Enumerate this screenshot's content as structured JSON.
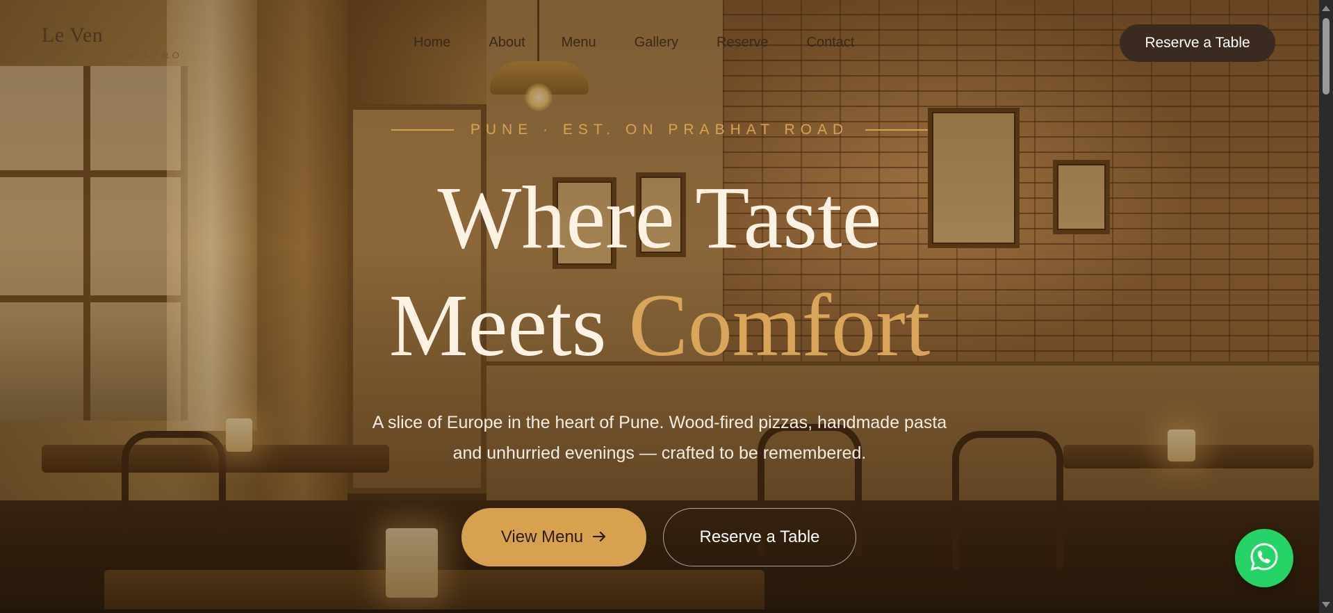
{
  "brand": {
    "name": "Le Ven",
    "tagline": "PIZZERIA · BISTRO"
  },
  "nav": {
    "items": [
      "Home",
      "About",
      "Menu",
      "Gallery",
      "Reserve",
      "Contact"
    ],
    "cta_label": "Reserve a Table"
  },
  "hero": {
    "eyebrow": "PUNE · EST. ON PRABHAT ROAD",
    "headline_line1": "Where Taste",
    "headline_line2_plain": "Meets ",
    "headline_line2_accent": "Comfort",
    "subtitle_line1": "A slice of Europe in the heart of Pune. Wood-fired pizzas, handmade pasta",
    "subtitle_line2": "and unhurried evenings — crafted to be remembered.",
    "primary_button": "View Menu",
    "primary_button_icon": "arrow-right-icon",
    "secondary_button": "Reserve a Table"
  },
  "floating": {
    "icon": "whatsapp-icon"
  },
  "colors": {
    "accent": "#d8a14f",
    "headline": "#fbf2e4",
    "nav_cta_bg": "#3b2a1f",
    "whatsapp": "#25d366"
  }
}
